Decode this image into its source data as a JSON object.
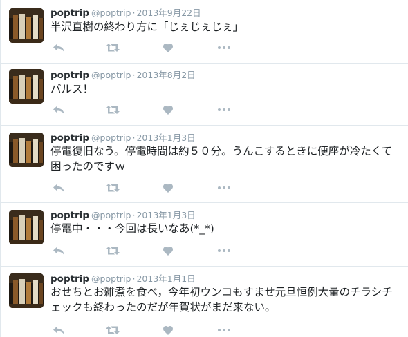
{
  "colors": {
    "icon_gray": "#abb8c2",
    "meta_gray": "#8899a6",
    "divider": "#e1e8ed"
  },
  "icons": {
    "reply": "reply-arrow-icon",
    "retweet": "retweet-icon",
    "favorite": "heart-icon",
    "more": "more-dots-icon",
    "avatar": "avatar-photo"
  },
  "tweets": [
    {
      "name": "poptrip",
      "handle": "@poptrip",
      "sep": "·",
      "time": "2013年9月22日",
      "text": "半沢直樹の終わり方に「じぇじぇじぇ」"
    },
    {
      "name": "poptrip",
      "handle": "@poptrip",
      "sep": "·",
      "time": "2013年8月2日",
      "text": "バルス！"
    },
    {
      "name": "poptrip",
      "handle": "@poptrip",
      "sep": "·",
      "time": "2013年1月3日",
      "text": "停電復旧なう。停電時間は約５０分。うんこするときに便座が冷たくて困ったのですｗ"
    },
    {
      "name": "poptrip",
      "handle": "@poptrip",
      "sep": "·",
      "time": "2013年1月3日",
      "text": "停電中・・・今回は長いなあ(*_*)"
    },
    {
      "name": "poptrip",
      "handle": "@poptrip",
      "sep": "·",
      "time": "2013年1月1日",
      "text": "おせちとお雑煮を食べ，今年初ウンコもすませ元旦恒例大量のチラシチェックも終わったのだが年賀状がまだ来ない。"
    }
  ]
}
